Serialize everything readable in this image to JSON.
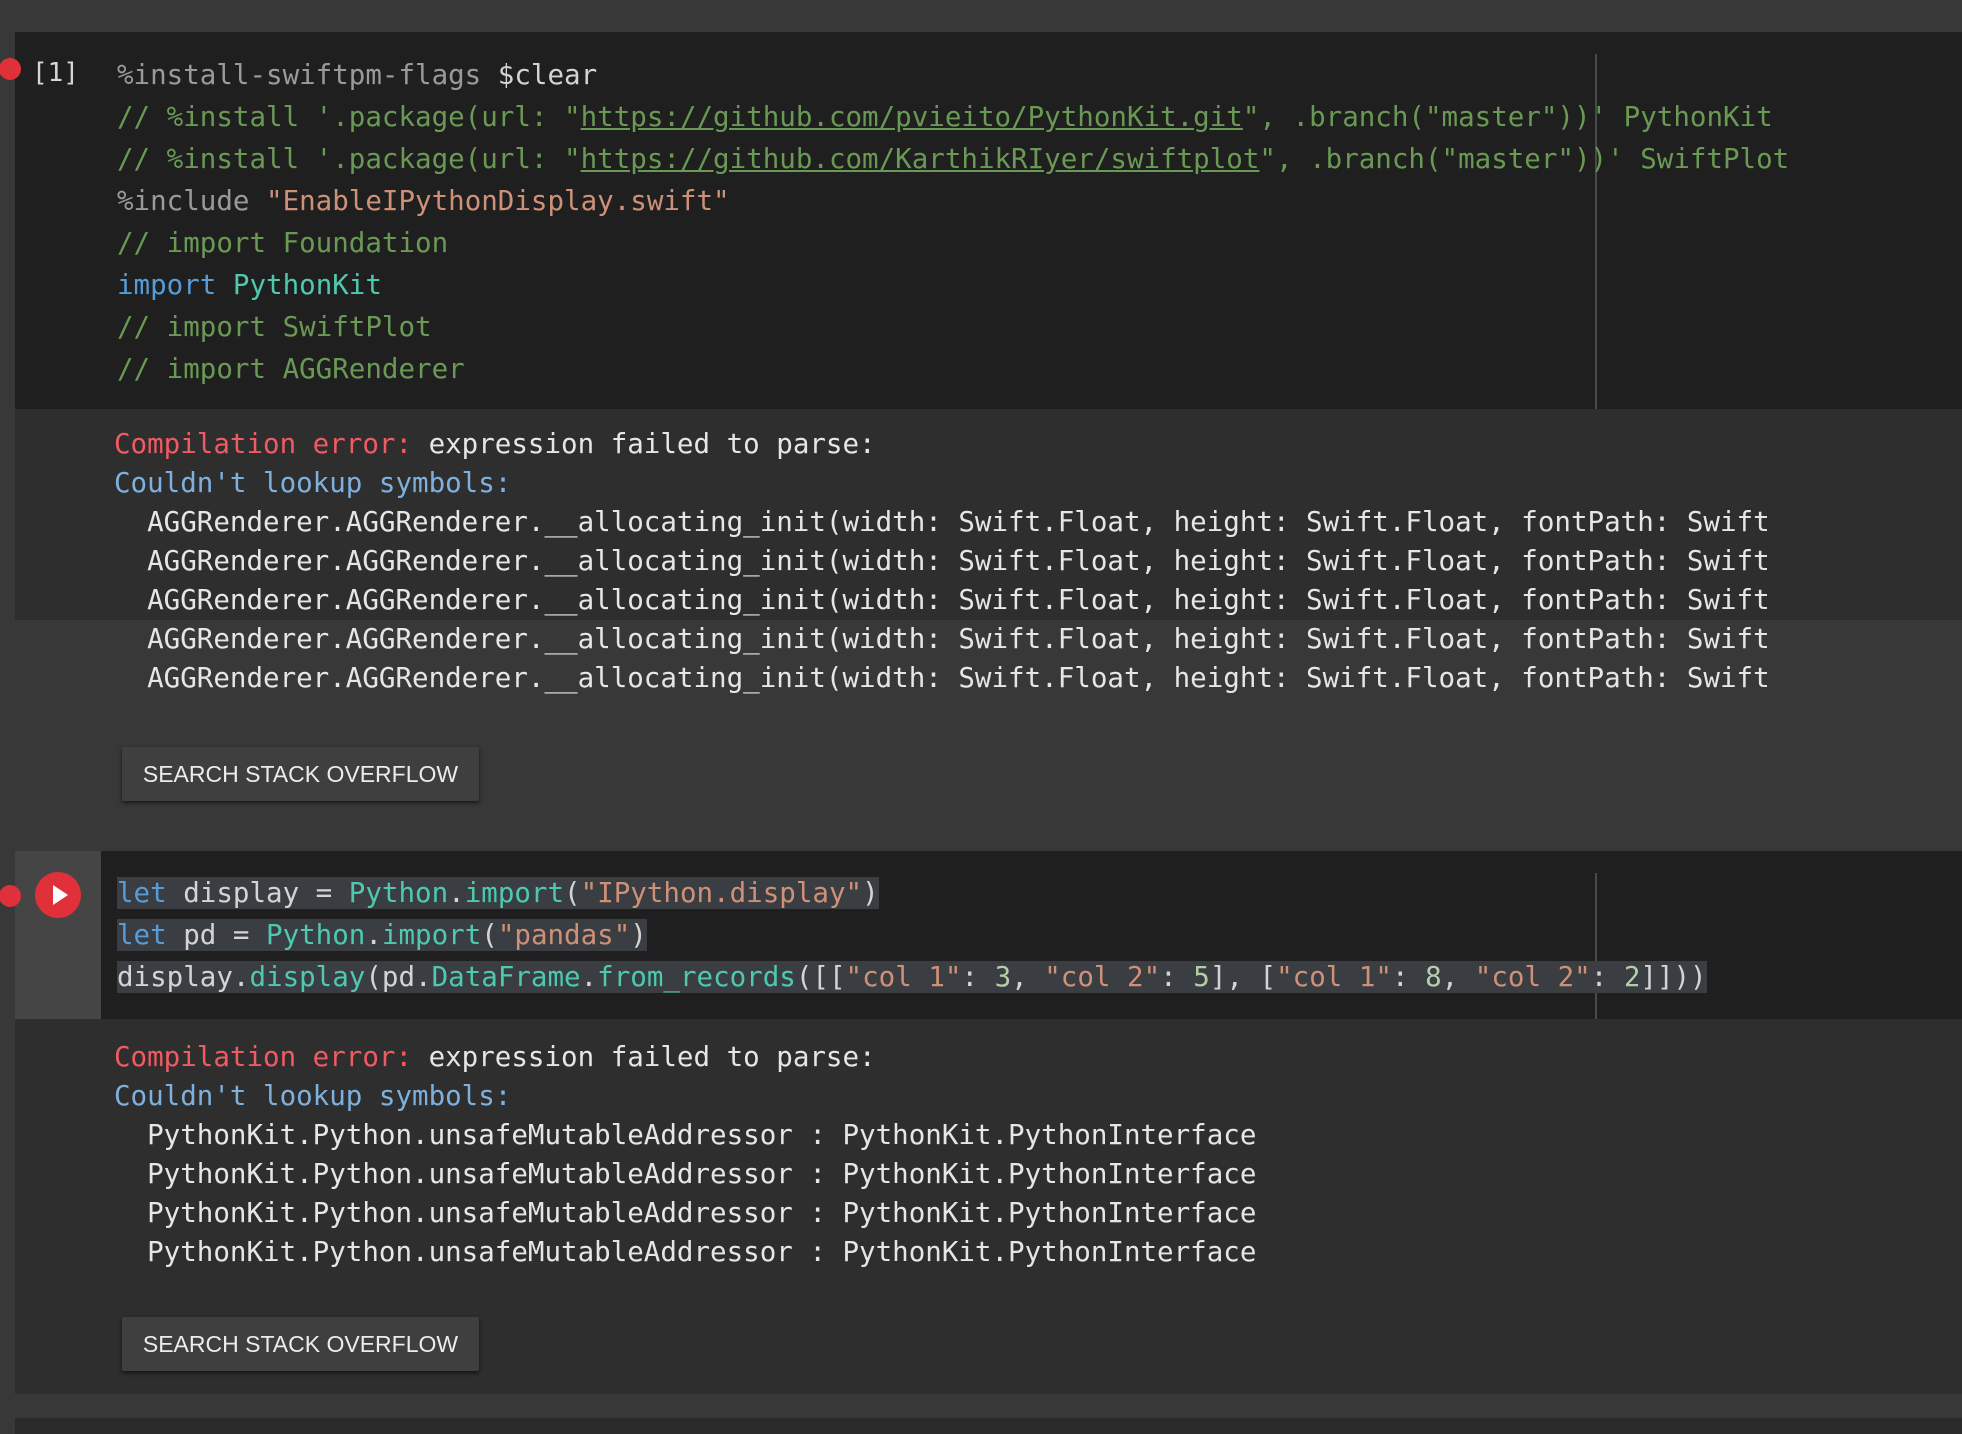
{
  "cell1": {
    "exec_count": "[1]",
    "code": [
      [
        {
          "t": "%install-swiftpm-flags",
          "c": "mg"
        },
        {
          "t": " $clear",
          "c": "plain"
        }
      ],
      [
        {
          "t": "// %install '.package(url: \"",
          "c": "c"
        },
        {
          "t": "https://github.com/pvieito/PythonKit.git",
          "c": "lnk"
        },
        {
          "t": "\", .branch(\"master\"))' PythonKit",
          "c": "c"
        }
      ],
      [
        {
          "t": "// %install '.package(url: \"",
          "c": "c"
        },
        {
          "t": "https://github.com/KarthikRIyer/swiftplot",
          "c": "lnk"
        },
        {
          "t": "\", .branch(\"master\"))' SwiftPlot",
          "c": "c"
        }
      ],
      [
        {
          "t": "%include ",
          "c": "mg"
        },
        {
          "t": "\"EnableIPythonDisplay.swift\"",
          "c": "str"
        }
      ],
      [
        {
          "t": "// import Foundation",
          "c": "c"
        }
      ],
      [
        {
          "t": "import",
          "c": "kw"
        },
        {
          "t": " ",
          "c": "plain"
        },
        {
          "t": "PythonKit",
          "c": "tp"
        }
      ],
      [
        {
          "t": "// import SwiftPlot",
          "c": "c"
        }
      ],
      [
        {
          "t": "// import AGGRenderer",
          "c": "c"
        }
      ]
    ],
    "output": {
      "error_label": "Compilation error:",
      "error_message": " expression failed to parse:",
      "lookup_label": "Couldn't lookup symbols:",
      "symbols": [
        "  AGGRenderer.AGGRenderer.__allocating_init(width: Swift.Float, height: Swift.Float, fontPath: Swift",
        "  AGGRenderer.AGGRenderer.__allocating_init(width: Swift.Float, height: Swift.Float, fontPath: Swift",
        "  AGGRenderer.AGGRenderer.__allocating_init(width: Swift.Float, height: Swift.Float, fontPath: Swift",
        "  AGGRenderer.AGGRenderer.__allocating_init(width: Swift.Float, height: Swift.Float, fontPath: Swift",
        "  AGGRenderer.AGGRenderer.__allocating_init(width: Swift.Float, height: Swift.Float, fontPath: Swift"
      ],
      "search_label": "SEARCH STACK OVERFLOW"
    }
  },
  "cell2": {
    "code": [
      [
        {
          "t": "let",
          "c": "kw"
        },
        {
          "t": " display = ",
          "c": "plain"
        },
        {
          "t": "Python",
          "c": "tp"
        },
        {
          "t": ".",
          "c": "plain"
        },
        {
          "t": "import",
          "c": "fn"
        },
        {
          "t": "(",
          "c": "plain"
        },
        {
          "t": "\"IPython.display\"",
          "c": "str"
        },
        {
          "t": ")",
          "c": "plain"
        }
      ],
      [
        {
          "t": "let",
          "c": "kw"
        },
        {
          "t": " pd = ",
          "c": "plain"
        },
        {
          "t": "Python",
          "c": "tp"
        },
        {
          "t": ".",
          "c": "plain"
        },
        {
          "t": "import",
          "c": "fn"
        },
        {
          "t": "(",
          "c": "plain"
        },
        {
          "t": "\"pandas\"",
          "c": "str"
        },
        {
          "t": ")",
          "c": "plain"
        }
      ],
      [
        {
          "t": "display.",
          "c": "plain"
        },
        {
          "t": "display",
          "c": "fn"
        },
        {
          "t": "(pd.",
          "c": "plain"
        },
        {
          "t": "DataFrame",
          "c": "tp"
        },
        {
          "t": ".",
          "c": "plain"
        },
        {
          "t": "from_records",
          "c": "fn"
        },
        {
          "t": "([[",
          "c": "plain"
        },
        {
          "t": "\"col 1\"",
          "c": "str"
        },
        {
          "t": ": ",
          "c": "plain"
        },
        {
          "t": "3",
          "c": "num"
        },
        {
          "t": ", ",
          "c": "plain"
        },
        {
          "t": "\"col 2\"",
          "c": "str"
        },
        {
          "t": ": ",
          "c": "plain"
        },
        {
          "t": "5",
          "c": "num"
        },
        {
          "t": "], [",
          "c": "plain"
        },
        {
          "t": "\"col 1\"",
          "c": "str"
        },
        {
          "t": ": ",
          "c": "plain"
        },
        {
          "t": "8",
          "c": "num"
        },
        {
          "t": ", ",
          "c": "plain"
        },
        {
          "t": "\"col 2\"",
          "c": "str"
        },
        {
          "t": ": ",
          "c": "plain"
        },
        {
          "t": "2",
          "c": "num"
        },
        {
          "t": "]]))",
          "c": "plain"
        }
      ]
    ],
    "output": {
      "error_label": "Compilation error:",
      "error_message": " expression failed to parse:",
      "lookup_label": "Couldn't lookup symbols:",
      "symbols": [
        "  PythonKit.Python.unsafeMutableAddressor : PythonKit.PythonInterface",
        "  PythonKit.Python.unsafeMutableAddressor : PythonKit.PythonInterface",
        "  PythonKit.Python.unsafeMutableAddressor : PythonKit.PythonInterface",
        "  PythonKit.Python.unsafeMutableAddressor : PythonKit.PythonInterface"
      ],
      "search_label": "SEARCH STACK OVERFLOW"
    }
  },
  "colors": {
    "error": "#f05a62",
    "run_button": "#e0303a",
    "comment": "#6a9955",
    "string": "#ce9178",
    "keyword": "#569cd6",
    "type": "#4ec9b0"
  }
}
